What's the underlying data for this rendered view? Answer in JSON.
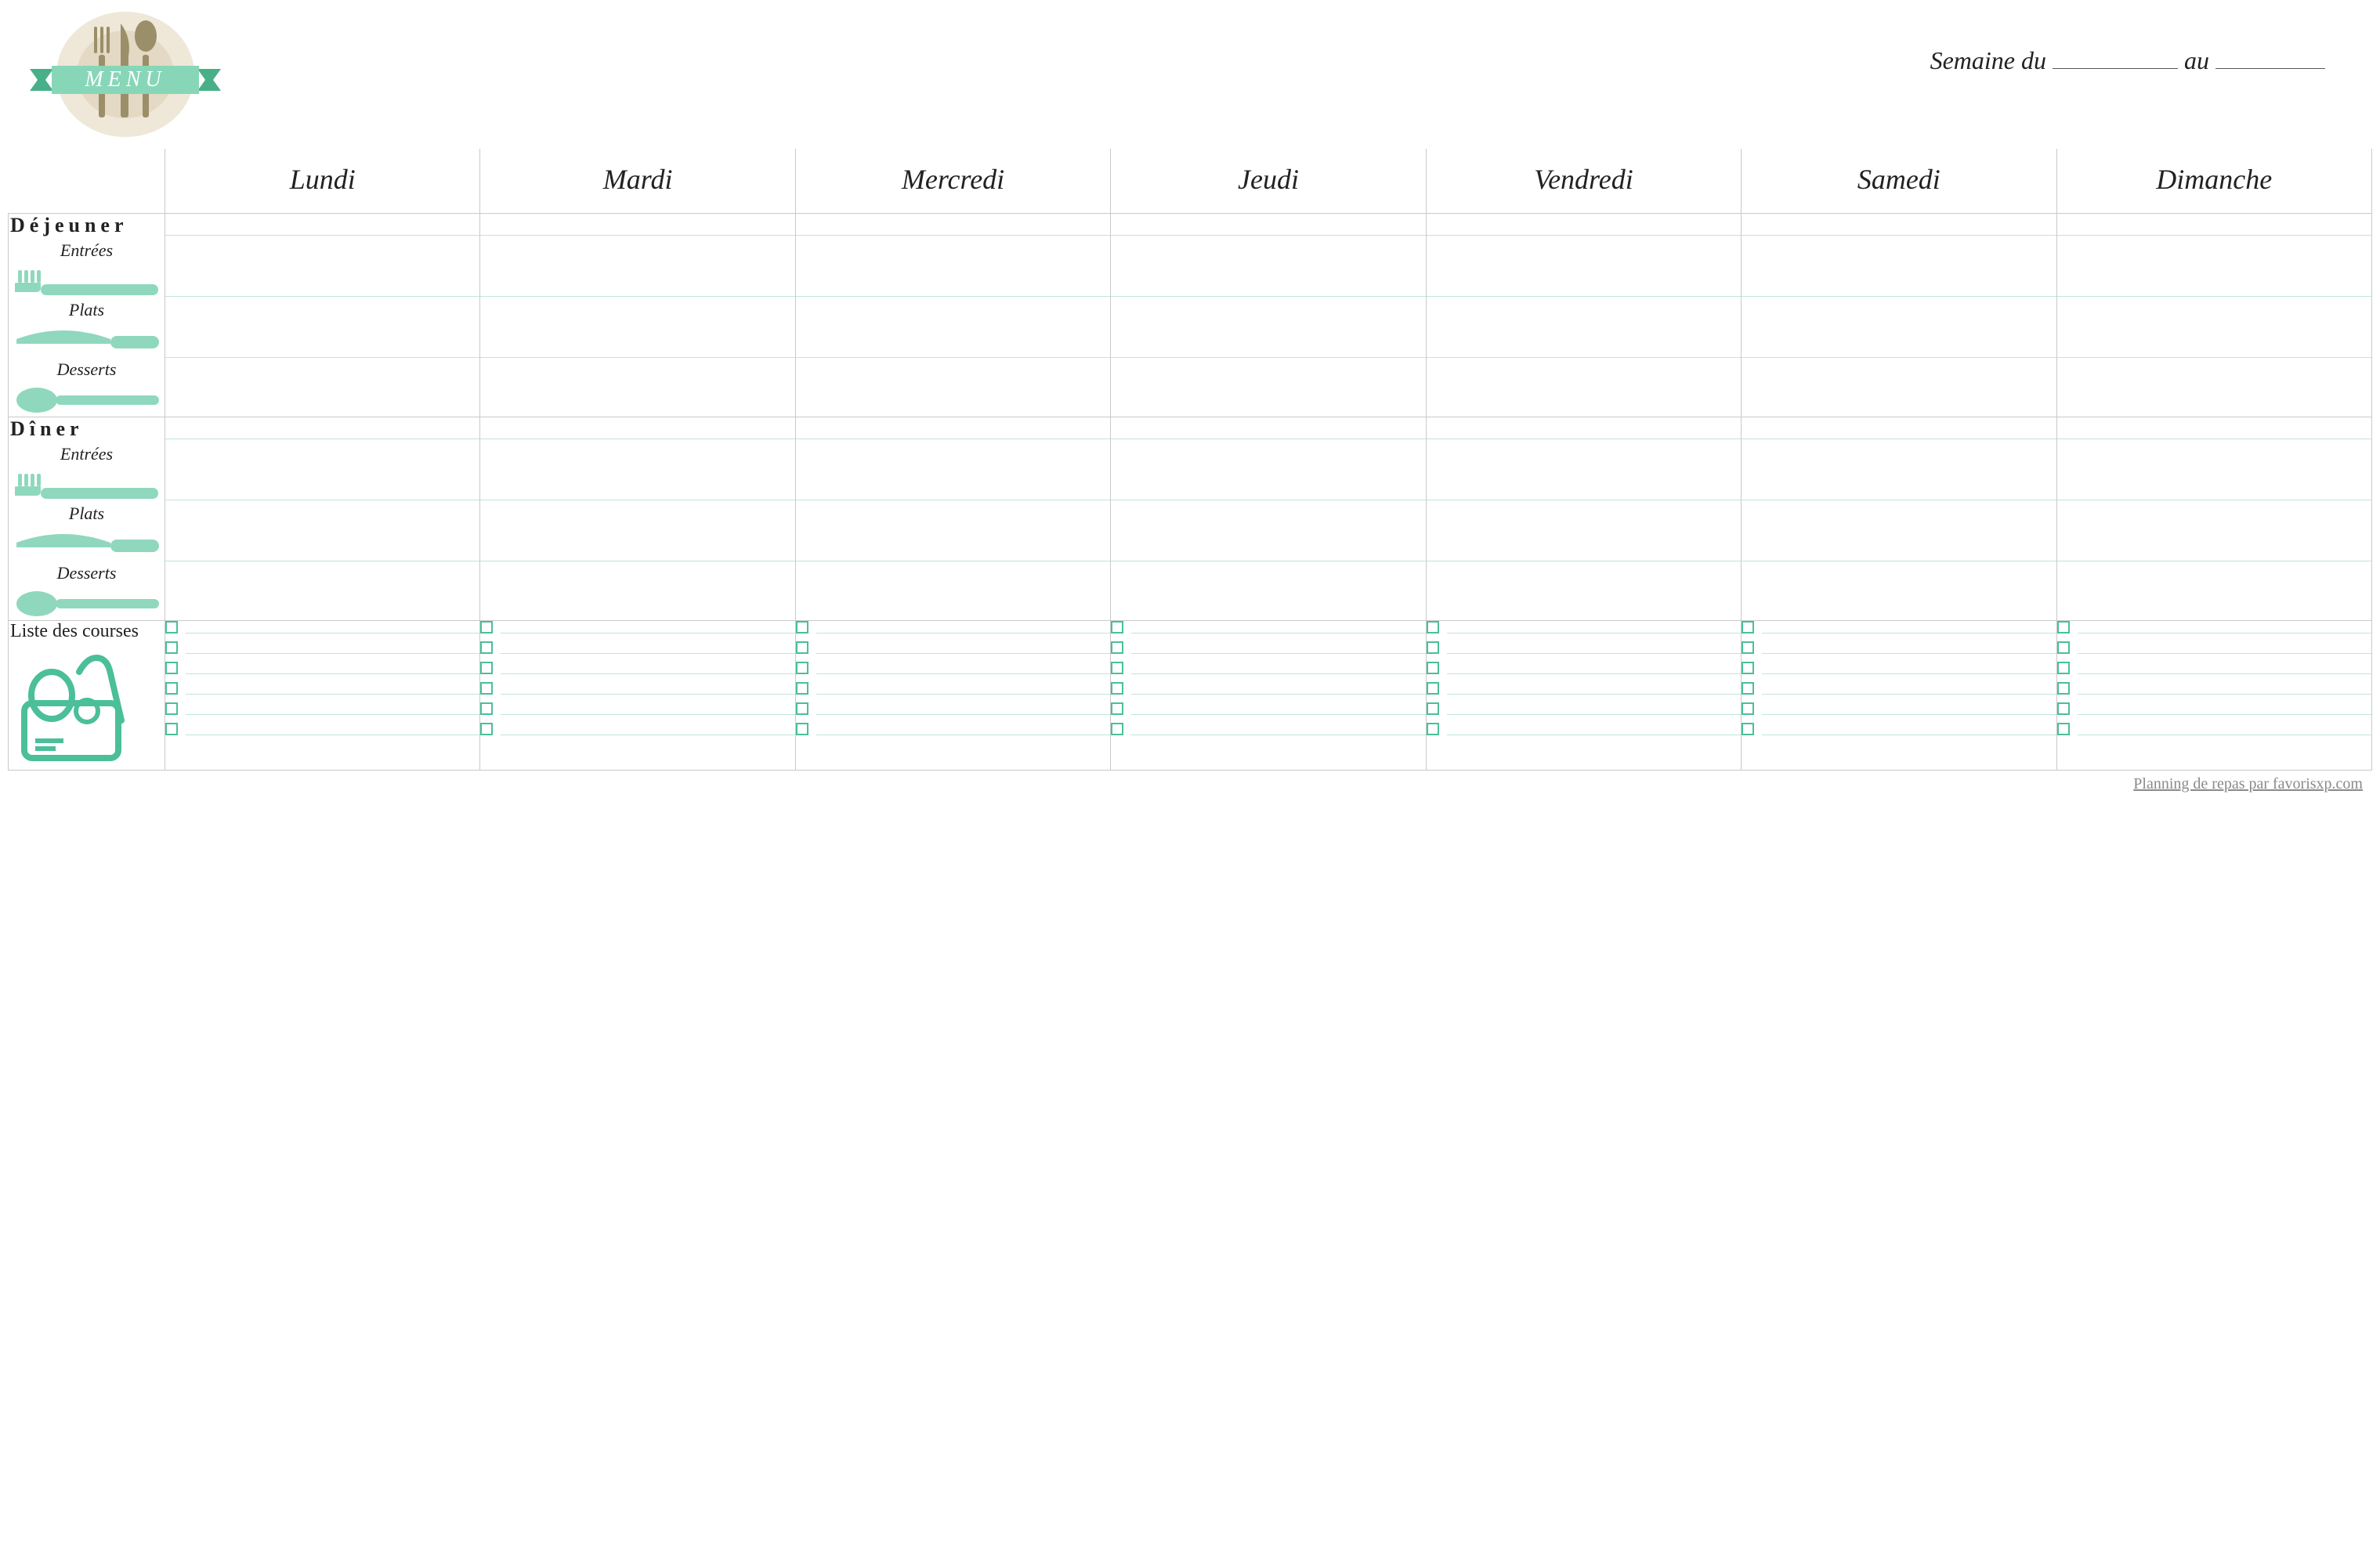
{
  "logo_text": "MENU",
  "week": {
    "label": "Semaine du",
    "sep": "au"
  },
  "days": [
    "Lundi",
    "Mardi",
    "Mercredi",
    "Jeudi",
    "Vendredi",
    "Samedi",
    "Dimanche"
  ],
  "meals": [
    {
      "title": "Déjeuner",
      "courses": [
        "Entrées",
        "Plats",
        "Desserts"
      ]
    },
    {
      "title": "Dîner",
      "courses": [
        "Entrées",
        "Plats",
        "Desserts"
      ]
    }
  ],
  "shopping": {
    "title": "Liste des courses",
    "rows_per_day": 6
  },
  "footer": "Planning de repas par favorisxp.com",
  "colors": {
    "mint": "#8fd8bd",
    "mint_dark": "#4bbf99",
    "line": "#bfe6d9",
    "border": "#c9c9c9"
  }
}
